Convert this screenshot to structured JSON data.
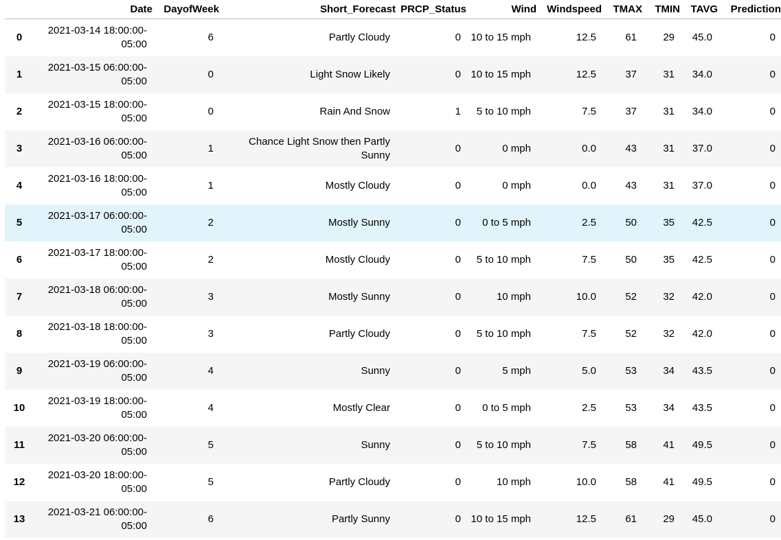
{
  "table": {
    "columns": {
      "date": "Date",
      "dayofweek": "DayofWeek",
      "short_forecast": "Short_Forecast",
      "prcp_status": "PRCP_Status",
      "wind": "Wind",
      "windspeed": "Windspeed",
      "tmax": "TMAX",
      "tmin": "TMIN",
      "tavg": "TAVG",
      "prediction": "Prediction"
    },
    "rows": [
      {
        "idx": "0",
        "date": "2021-03-14 18:00:00-05:00",
        "dayofweek": "6",
        "short_forecast": "Partly Cloudy",
        "prcp_status": "0",
        "wind": "10 to 15 mph",
        "windspeed": "12.5",
        "tmax": "61",
        "tmin": "29",
        "tavg": "45.0",
        "prediction": "0"
      },
      {
        "idx": "1",
        "date": "2021-03-15 06:00:00-05:00",
        "dayofweek": "0",
        "short_forecast": "Light Snow Likely",
        "prcp_status": "0",
        "wind": "10 to 15 mph",
        "windspeed": "12.5",
        "tmax": "37",
        "tmin": "31",
        "tavg": "34.0",
        "prediction": "0"
      },
      {
        "idx": "2",
        "date": "2021-03-15 18:00:00-05:00",
        "dayofweek": "0",
        "short_forecast": "Rain And Snow",
        "prcp_status": "1",
        "wind": "5 to 10 mph",
        "windspeed": "7.5",
        "tmax": "37",
        "tmin": "31",
        "tavg": "34.0",
        "prediction": "0"
      },
      {
        "idx": "3",
        "date": "2021-03-16 06:00:00-05:00",
        "dayofweek": "1",
        "short_forecast": "Chance Light Snow then Partly Sunny",
        "prcp_status": "0",
        "wind": "0 mph",
        "windspeed": "0.0",
        "tmax": "43",
        "tmin": "31",
        "tavg": "37.0",
        "prediction": "0"
      },
      {
        "idx": "4",
        "date": "2021-03-16 18:00:00-05:00",
        "dayofweek": "1",
        "short_forecast": "Mostly Cloudy",
        "prcp_status": "0",
        "wind": "0 mph",
        "windspeed": "0.0",
        "tmax": "43",
        "tmin": "31",
        "tavg": "37.0",
        "prediction": "0"
      },
      {
        "idx": "5",
        "date": "2021-03-17 06:00:00-05:00",
        "dayofweek": "2",
        "short_forecast": "Mostly Sunny",
        "prcp_status": "0",
        "wind": "0 to 5 mph",
        "windspeed": "2.5",
        "tmax": "50",
        "tmin": "35",
        "tavg": "42.5",
        "prediction": "0"
      },
      {
        "idx": "6",
        "date": "2021-03-17 18:00:00-05:00",
        "dayofweek": "2",
        "short_forecast": "Mostly Cloudy",
        "prcp_status": "0",
        "wind": "5 to 10 mph",
        "windspeed": "7.5",
        "tmax": "50",
        "tmin": "35",
        "tavg": "42.5",
        "prediction": "0"
      },
      {
        "idx": "7",
        "date": "2021-03-18 06:00:00-05:00",
        "dayofweek": "3",
        "short_forecast": "Mostly Sunny",
        "prcp_status": "0",
        "wind": "10 mph",
        "windspeed": "10.0",
        "tmax": "52",
        "tmin": "32",
        "tavg": "42.0",
        "prediction": "0"
      },
      {
        "idx": "8",
        "date": "2021-03-18 18:00:00-05:00",
        "dayofweek": "3",
        "short_forecast": "Partly Cloudy",
        "prcp_status": "0",
        "wind": "5 to 10 mph",
        "windspeed": "7.5",
        "tmax": "52",
        "tmin": "32",
        "tavg": "42.0",
        "prediction": "0"
      },
      {
        "idx": "9",
        "date": "2021-03-19 06:00:00-05:00",
        "dayofweek": "4",
        "short_forecast": "Sunny",
        "prcp_status": "0",
        "wind": "5 mph",
        "windspeed": "5.0",
        "tmax": "53",
        "tmin": "34",
        "tavg": "43.5",
        "prediction": "0"
      },
      {
        "idx": "10",
        "date": "2021-03-19 18:00:00-05:00",
        "dayofweek": "4",
        "short_forecast": "Mostly Clear",
        "prcp_status": "0",
        "wind": "0 to 5 mph",
        "windspeed": "2.5",
        "tmax": "53",
        "tmin": "34",
        "tavg": "43.5",
        "prediction": "0"
      },
      {
        "idx": "11",
        "date": "2021-03-20 06:00:00-05:00",
        "dayofweek": "5",
        "short_forecast": "Sunny",
        "prcp_status": "0",
        "wind": "5 to 10 mph",
        "windspeed": "7.5",
        "tmax": "58",
        "tmin": "41",
        "tavg": "49.5",
        "prediction": "0"
      },
      {
        "idx": "12",
        "date": "2021-03-20 18:00:00-05:00",
        "dayofweek": "5",
        "short_forecast": "Partly Cloudy",
        "prcp_status": "0",
        "wind": "10 mph",
        "windspeed": "10.0",
        "tmax": "58",
        "tmin": "41",
        "tavg": "49.5",
        "prediction": "0"
      },
      {
        "idx": "13",
        "date": "2021-03-21 06:00:00-05:00",
        "dayofweek": "6",
        "short_forecast": "Partly Sunny",
        "prcp_status": "0",
        "wind": "10 to 15 mph",
        "windspeed": "12.5",
        "tmax": "61",
        "tmin": "29",
        "tavg": "45.0",
        "prediction": "0"
      }
    ],
    "hover_row_color": "#e1f3fb",
    "stripe_color": "#f5f5f5"
  }
}
